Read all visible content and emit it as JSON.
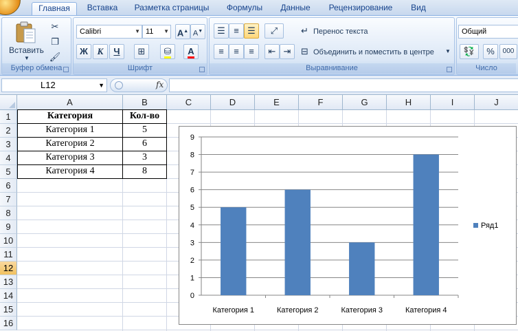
{
  "ribbon": {
    "tabs": [
      "Главная",
      "Вставка",
      "Разметка страницы",
      "Формулы",
      "Данные",
      "Рецензирование",
      "Вид"
    ],
    "active_tab": "Главная",
    "clipboard": {
      "paste_label": "Вставить",
      "group_label": "Буфер обмена"
    },
    "font": {
      "font_name": "Calibri",
      "font_size": "11",
      "bold": "Ж",
      "italic": "К",
      "underline": "Ч",
      "grow": "A",
      "shrink": "A",
      "color_letter": "A",
      "group_label": "Шрифт"
    },
    "alignment": {
      "wrap_text": "Перенос текста",
      "merge_center": "Объединить и поместить в центре",
      "group_label": "Выравнивание"
    },
    "number": {
      "format": "Общий",
      "percent": "%",
      "thousands": "000",
      "group_label": "Число"
    }
  },
  "formula_bar": {
    "name_box": "L12",
    "fx_label": "fx",
    "formula": ""
  },
  "sheet": {
    "columns": [
      "A",
      "B",
      "C",
      "D",
      "E",
      "F",
      "G",
      "H",
      "I",
      "J"
    ],
    "rows": [
      "1",
      "2",
      "3",
      "4",
      "5",
      "6",
      "7",
      "8",
      "9",
      "10",
      "11",
      "12",
      "13",
      "14",
      "15",
      "16"
    ],
    "selected_row": "12",
    "table": {
      "headers": [
        "Категория",
        "Кол-во"
      ],
      "rows": [
        [
          "Категория 1",
          "5"
        ],
        [
          "Категория 2",
          "6"
        ],
        [
          "Категория 3",
          "3"
        ],
        [
          "Категория 4",
          "8"
        ]
      ]
    }
  },
  "chart_data": {
    "type": "bar",
    "categories": [
      "Категория 1",
      "Категория 2",
      "Категория 3",
      "Категория 4"
    ],
    "series": [
      {
        "name": "Ряд1",
        "values": [
          5,
          6,
          3,
          8
        ],
        "color": "#4f81bd"
      }
    ],
    "title": "",
    "xlabel": "",
    "ylabel": "",
    "ylim": [
      0,
      9
    ],
    "yticks": [
      "0",
      "1",
      "2",
      "3",
      "4",
      "5",
      "6",
      "7",
      "8",
      "9"
    ],
    "grid": true,
    "legend_position": "right"
  },
  "colors": {
    "bar": "#4f81bd",
    "selection": "#f1c15f",
    "ribbon_text": "#15428b"
  }
}
